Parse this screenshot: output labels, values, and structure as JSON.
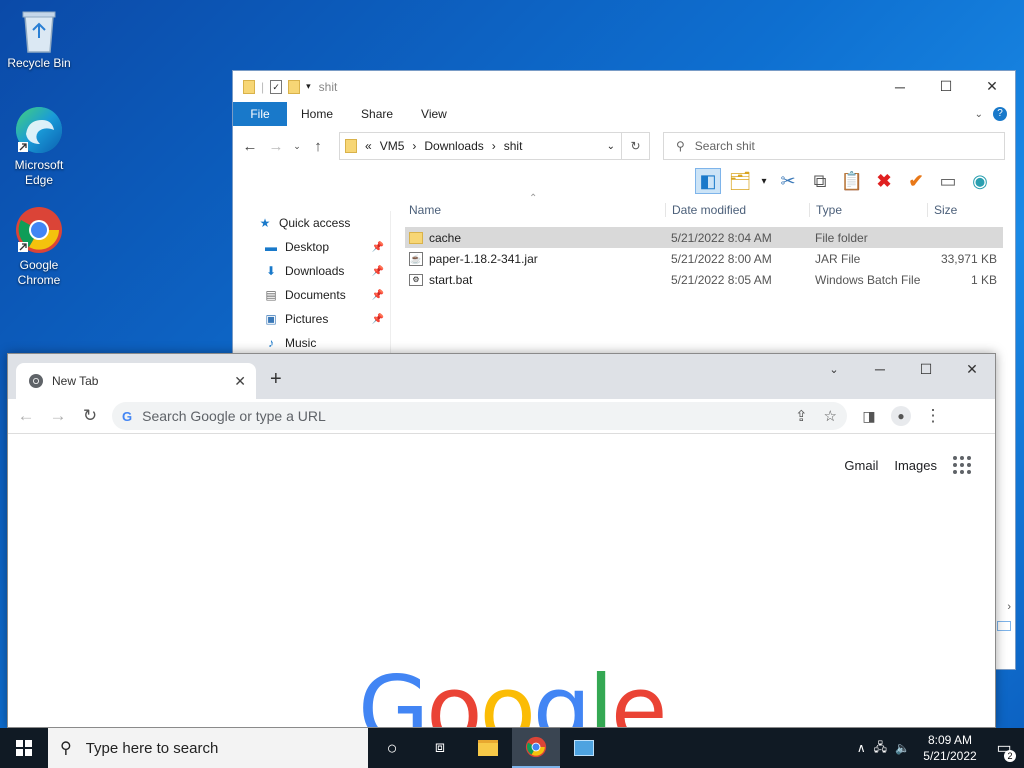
{
  "desktop": {
    "icons": [
      {
        "label": "Recycle Bin"
      },
      {
        "label": "Microsoft Edge"
      },
      {
        "label": "Google Chrome"
      }
    ]
  },
  "explorer": {
    "title": "shit",
    "ribbon_tabs": [
      "File",
      "Home",
      "Share",
      "View"
    ],
    "breadcrumb": [
      "VM5",
      "Downloads",
      "shit"
    ],
    "search_placeholder": "Search shit",
    "nav": [
      {
        "label": "Quick access",
        "icon": "star-icon"
      },
      {
        "label": "Desktop",
        "icon": "desktop-icon"
      },
      {
        "label": "Downloads",
        "icon": "downloads-icon"
      },
      {
        "label": "Documents",
        "icon": "documents-icon"
      },
      {
        "label": "Pictures",
        "icon": "pictures-icon"
      },
      {
        "label": "Music",
        "icon": "music-icon"
      }
    ],
    "columns": [
      "Name",
      "Date modified",
      "Type",
      "Size"
    ],
    "files": [
      {
        "name": "cache",
        "date": "5/21/2022 8:04 AM",
        "type": "File folder",
        "size": "",
        "icon": "folder-icon"
      },
      {
        "name": "paper-1.18.2-341.jar",
        "date": "5/21/2022 8:00 AM",
        "type": "JAR File",
        "size": "33,971 KB",
        "icon": "jar-file-icon"
      },
      {
        "name": "start.bat",
        "date": "5/21/2022 8:05 AM",
        "type": "Windows Batch File",
        "size": "1 KB",
        "icon": "batch-file-icon"
      }
    ]
  },
  "chrome": {
    "tab_title": "New Tab",
    "omnibox_placeholder": "Search Google or type a URL",
    "links": [
      "Gmail",
      "Images"
    ],
    "logo_letters": [
      "G",
      "o",
      "o",
      "g",
      "l",
      "e"
    ],
    "logo_colors": [
      "#4285F4",
      "#EA4335",
      "#FBBC05",
      "#4285F4",
      "#34A853",
      "#EA4335"
    ]
  },
  "taskbar": {
    "search_placeholder": "Type here to search",
    "time": "8:09 AM",
    "date": "5/21/2022",
    "notification_count": "2"
  }
}
